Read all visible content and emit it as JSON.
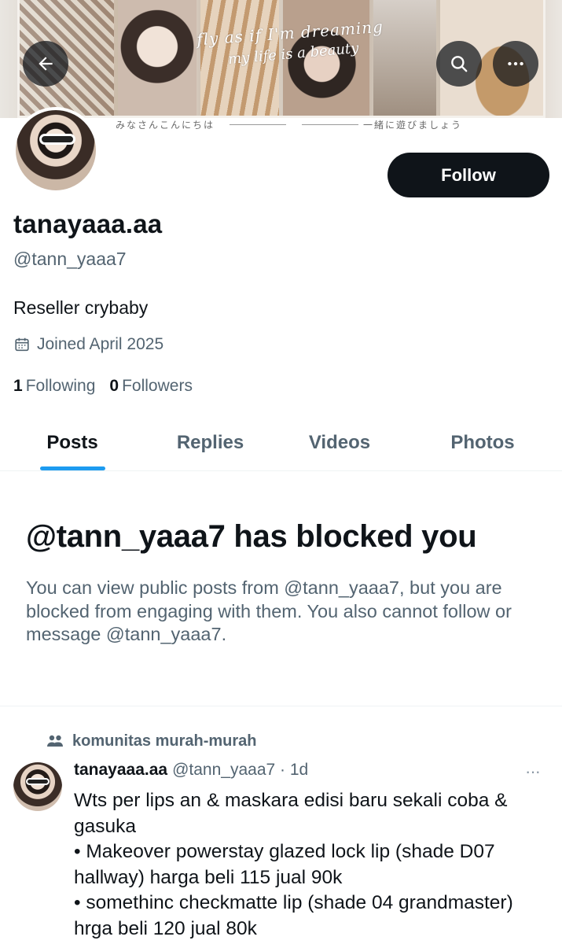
{
  "banner": {
    "script_line1": "fly as if I'm dreaming",
    "script_line2": "my life is a beauty",
    "caption_left": "みなさんこんにちは",
    "caption_right": "一緒に遊びましょう"
  },
  "profile": {
    "display_name": "tanayaaa.aa",
    "handle": "@tann_yaaa7",
    "bio": "Reseller crybaby",
    "joined": "Joined April 2025",
    "following_count": "1",
    "following_label": "Following",
    "followers_count": "0",
    "followers_label": "Followers",
    "follow_button": "Follow"
  },
  "tabs": [
    "Posts",
    "Replies",
    "Videos",
    "Photos"
  ],
  "blocked": {
    "title": "@tann_yaaa7 has blocked you",
    "text": "You can view public posts from @tann_yaaa7, but you are blocked from engaging with them. You also cannot follow or message @tann_yaaa7."
  },
  "post": {
    "community": "komunitas murah-murah",
    "author_name": "tanayaaa.aa",
    "author_meta": "@tann_yaaa7 · 1d",
    "more": "···",
    "body": "Wts per lips an & maskara edisi baru sekali coba & gasuka\n• Makeover powerstay glazed lock lip (shade D07 hallway) harga beli 115 jual 90k\n• somethinc checkmatte lip (shade 04 grandmaster) hrga beli 120 jual 80k"
  },
  "icons": {
    "back": "arrow-left-icon",
    "search": "search-icon",
    "more": "more-horizontal-icon",
    "calendar": "calendar-icon",
    "community": "community-icon"
  },
  "colors": {
    "text_primary": "#0f1419",
    "text_secondary": "#536471",
    "accent": "#1d9bf0",
    "border": "#eff3f4"
  }
}
